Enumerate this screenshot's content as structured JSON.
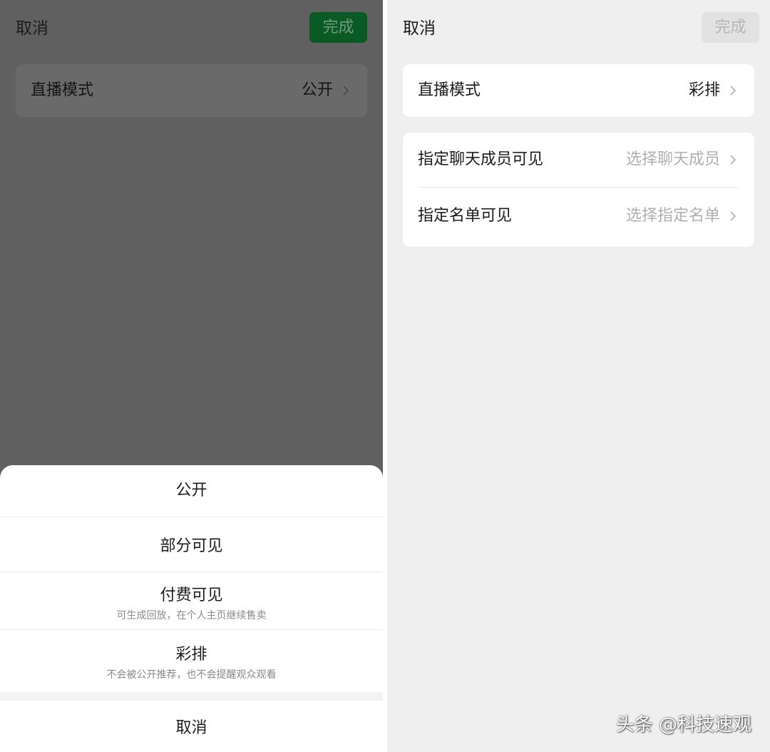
{
  "left": {
    "topbar": {
      "cancel_label": "取消",
      "done_label": "完成"
    },
    "mode_row": {
      "label": "直播模式",
      "value": "公开"
    },
    "sheet": {
      "options": [
        {
          "title": "公开",
          "subtitle": ""
        },
        {
          "title": "部分可见",
          "subtitle": ""
        },
        {
          "title": "付费可见",
          "subtitle": "可生成回放，在个人主页继续售卖"
        },
        {
          "title": "彩排",
          "subtitle": "不会被公开推荐，也不会提醒观众观看"
        }
      ],
      "cancel_label": "取消"
    }
  },
  "right": {
    "topbar": {
      "cancel_label": "取消",
      "done_label": "完成"
    },
    "mode_row": {
      "label": "直播模式",
      "value": "彩排"
    },
    "visibility_rows": [
      {
        "label": "指定聊天成员可见",
        "value": "选择聊天成员"
      },
      {
        "label": "指定名单可见",
        "value": "选择指定名单"
      }
    ],
    "watermark": "头条 @科技速观"
  },
  "colors": {
    "done_active_bg": "#0a5a26",
    "done_disabled_bg": "#e2e2e2",
    "overlay": "#606060",
    "page_bg": "#efefef"
  },
  "icons": {
    "row_chevron": "chevron-right-icon"
  }
}
